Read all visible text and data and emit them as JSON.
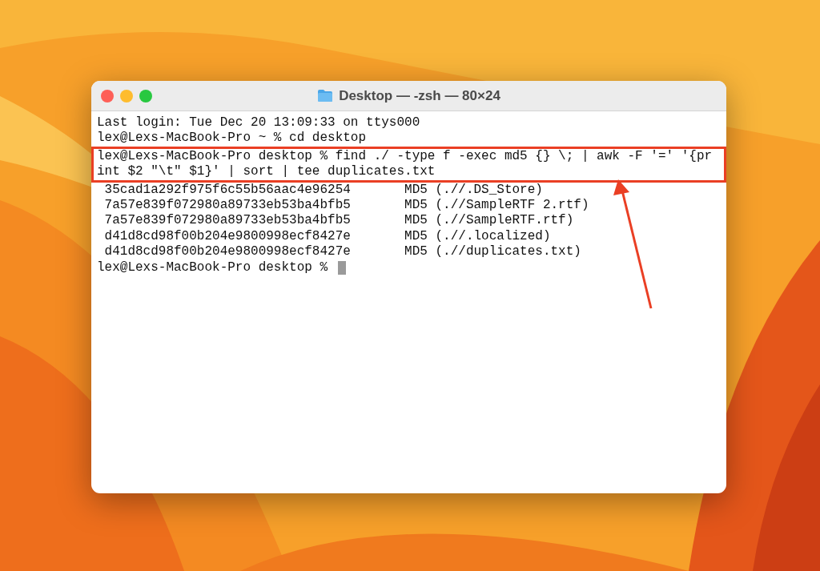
{
  "window": {
    "title": "Desktop — -zsh — 80×24"
  },
  "terminal": {
    "lines": [
      {
        "text": "Last login: Tue Dec 20 13:09:33 on ttys000",
        "highlighted": false
      },
      {
        "text": "lex@Lexs-MacBook-Pro ~ % cd desktop",
        "highlighted": false
      },
      {
        "text": "lex@Lexs-MacBook-Pro desktop % find ./ -type f -exec md5 {} \\; | awk -F '=' '{pr",
        "highlighted": true
      },
      {
        "text": "int $2 \"\\t\" $1}' | sort | tee duplicates.txt",
        "highlighted": true
      },
      {
        "text": " 35cad1a292f975f6c55b56aac4e96254       MD5 (.//.DS_Store)",
        "highlighted": false
      },
      {
        "text": " 7a57e839f072980a89733eb53ba4bfb5       MD5 (.//SampleRTF 2.rtf)",
        "highlighted": false
      },
      {
        "text": " 7a57e839f072980a89733eb53ba4bfb5       MD5 (.//SampleRTF.rtf)",
        "highlighted": false
      },
      {
        "text": " d41d8cd98f00b204e9800998ecf8427e       MD5 (.//.localized)",
        "highlighted": false
      },
      {
        "text": " d41d8cd98f00b204e9800998ecf8427e       MD5 (.//duplicates.txt)",
        "highlighted": false
      },
      {
        "text": "lex@Lexs-MacBook-Pro desktop % ",
        "highlighted": false
      }
    ]
  }
}
